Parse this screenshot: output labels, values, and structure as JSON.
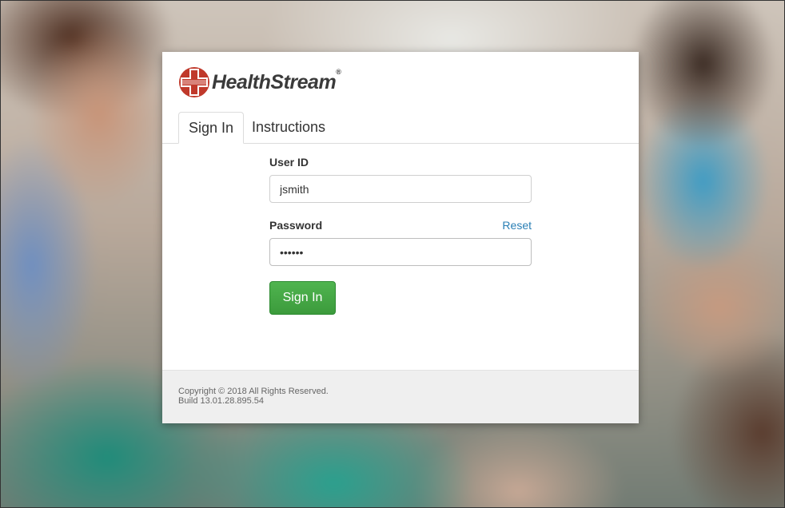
{
  "brand": {
    "name": "HealthStream",
    "registered_mark": "®",
    "logo_icon": "healthstream-cross-logo",
    "logo_color": "#c0392b"
  },
  "tabs": [
    {
      "label": "Sign In",
      "active": true
    },
    {
      "label": "Instructions",
      "active": false
    }
  ],
  "form": {
    "user_id_label": "User ID",
    "user_id_value": "jsmith",
    "password_label": "Password",
    "password_value": "••••••",
    "reset_label": "Reset",
    "submit_label": "Sign In"
  },
  "footer": {
    "copyright": "Copyright © 2018   All Rights Reserved.",
    "build": "Build 13.01.28.895.54"
  },
  "colors": {
    "accent_link": "#2a7fb5",
    "button_green": "#44a844"
  }
}
